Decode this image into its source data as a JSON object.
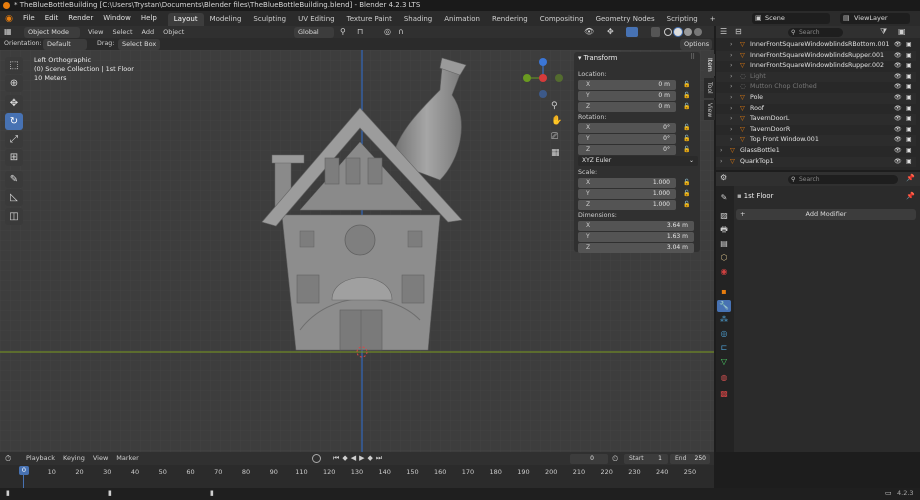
{
  "window": {
    "title": "* TheBlueBottleBuilding [C:\\Users\\Trystan\\Documents\\Blender files\\TheBlueBottleBuilding.blend] - Blender 4.2.3 LTS"
  },
  "menu": [
    "File",
    "Edit",
    "Render",
    "Window",
    "Help"
  ],
  "workspaces": [
    "Layout",
    "Modeling",
    "Sculpting",
    "UV Editing",
    "Texture Paint",
    "Shading",
    "Animation",
    "Rendering",
    "Compositing",
    "Geometry Nodes",
    "Scripting"
  ],
  "workspace_add": "+",
  "scene": {
    "name": "Scene",
    "view_layer": "ViewLayer"
  },
  "viewport_header": {
    "mode": "Object Mode",
    "menus": [
      "View",
      "Select",
      "Add",
      "Object"
    ],
    "transform_orientation": "Global",
    "orientation_label": "Orientation:",
    "orientation_value": "Default",
    "drag_label": "Drag:",
    "drag_value": "Select Box",
    "options": "Options"
  },
  "viewport_info": {
    "line1": "Left Orthographic",
    "line2": "(0) Scene Collection | 1st Floor",
    "line3": "10 Meters"
  },
  "n_panel_tabs": [
    "Item",
    "Tool",
    "View"
  ],
  "transform": {
    "header": "Transform",
    "location_label": "Location:",
    "location": [
      {
        "axis": "X",
        "value": "0 m"
      },
      {
        "axis": "Y",
        "value": "0 m"
      },
      {
        "axis": "Z",
        "value": "0 m"
      }
    ],
    "rotation_label": "Rotation:",
    "rotation": [
      {
        "axis": "X",
        "value": "0°"
      },
      {
        "axis": "Y",
        "value": "0°"
      },
      {
        "axis": "Z",
        "value": "0°"
      }
    ],
    "rotation_mode": "XYZ Euler",
    "scale_label": "Scale:",
    "scale": [
      {
        "axis": "X",
        "value": "1.000"
      },
      {
        "axis": "Y",
        "value": "1.000"
      },
      {
        "axis": "Z",
        "value": "1.000"
      }
    ],
    "dimensions_label": "Dimensions:",
    "dimensions": [
      {
        "axis": "X",
        "value": "3.64 m"
      },
      {
        "axis": "Y",
        "value": "1.63 m"
      },
      {
        "axis": "Z",
        "value": "3.04 m"
      }
    ]
  },
  "outliner": {
    "search_placeholder": "Search",
    "items": [
      {
        "label": "InnerFrontSquareWindowblindsRBottom.001",
        "dim": false
      },
      {
        "label": "InnerFrontSquareWindowblindsRupper.001",
        "dim": false
      },
      {
        "label": "InnerFrontSquareWindowblindsRupper.002",
        "dim": false
      },
      {
        "label": "Light",
        "dim": true
      },
      {
        "label": "Mutton Chop Clothed",
        "dim": true
      },
      {
        "label": "Pole",
        "dim": false
      },
      {
        "label": "Roof",
        "dim": false
      },
      {
        "label": "TavernDoorL",
        "dim": false
      },
      {
        "label": "TavernDoorR",
        "dim": false
      },
      {
        "label": "Top Front Window.001",
        "dim": false
      },
      {
        "label": "GlassBottle1",
        "dim": false
      },
      {
        "label": "QuarkTop1",
        "dim": false
      }
    ]
  },
  "properties": {
    "search_placeholder": "Search",
    "object_name": "1st Floor",
    "add_modifier": "Add Modifier"
  },
  "timeline": {
    "menus": [
      "Playback",
      "Keying",
      "View",
      "Marker"
    ],
    "current_frame": "0",
    "start_label": "Start",
    "start": "1",
    "end_label": "End",
    "end": "250",
    "ticks": [
      "0",
      "10",
      "20",
      "30",
      "40",
      "50",
      "60",
      "70",
      "80",
      "90",
      "110",
      "120",
      "130",
      "140",
      "150",
      "160",
      "170",
      "180",
      "190",
      "200",
      "210",
      "220",
      "230",
      "240",
      "250"
    ]
  },
  "status": {
    "version": "4.2.3"
  },
  "colors": {
    "accent": "#4772b3",
    "selection_orange": "#e87d0d",
    "mesh_gray": "#8c8c8c",
    "viewport_bg": "#3d3d3d"
  }
}
